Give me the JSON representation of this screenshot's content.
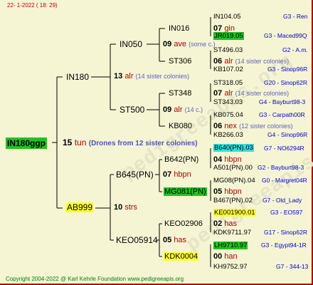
{
  "header": {
    "date": "22-  1-2022 ( 18: 29)"
  },
  "footer": {
    "copyright": "Copyright 2004-2022 @ Karl Kehrle Foundation    www.pedigreeapis.org"
  },
  "watermark": {
    "text": "pedigreeapis.org"
  },
  "root": {
    "id": "IN180ggp",
    "generation": "15",
    "queen": "tun",
    "colonies": "(Drones from 12 sister colonies)"
  },
  "sire_side": {
    "id": "IN180",
    "generation": "13",
    "queen": "alr",
    "colonies": "(14 sister colonies)",
    "a": {
      "id": "IN050",
      "generation": "09",
      "queen": "ave",
      "colonies": "(some c.)",
      "a": {
        "id": "IN016",
        "generation": "07",
        "queen": "gin",
        "a": {
          "id": "IN104.05",
          "info": "G3 - Ren"
        },
        "b": {
          "id": "JR019.05",
          "info": "G3 - Maced99Q"
        }
      },
      "b": {
        "id": "ST306",
        "generation": "06",
        "queen": "alr",
        "colonies": "(14 sister colonies)",
        "a": {
          "id": "ST496.03",
          "info": "G2 - A.m."
        },
        "b": {
          "id": "KB107.02",
          "info": "G3 - Sinop96R"
        }
      }
    },
    "b": {
      "id": "ST500",
      "generation": "09",
      "queen": "alr",
      "colonies": "(14 c.)",
      "a": {
        "id": "ST348",
        "generation": "07",
        "queen": "alr",
        "colonies": "(14 sister colonies)",
        "a": {
          "id": "ST318.05",
          "info": "G20 - Sinop62R"
        },
        "b": {
          "id": "ST343.03",
          "info": "G4 - Bayburt98-3"
        }
      },
      "b": {
        "id": "KB080",
        "generation": "06",
        "queen": "nex",
        "colonies": "(12 sister colonies)",
        "a": {
          "id": "KB075.04",
          "info": "G3 - Carpath00R"
        },
        "b": {
          "id": "KB266.03",
          "info": "G4 - Sinop96R"
        }
      }
    }
  },
  "dam_side": {
    "id": "AB999",
    "generation": "10",
    "queen": "strs",
    "a": {
      "id": "B645(PN)",
      "generation": "07",
      "queen": "hbpn",
      "a": {
        "id": "B642(PN)",
        "generation": "04",
        "queen": "hbpn",
        "a": {
          "id": "B640(PN).03",
          "info": "G7 - NO6294R"
        },
        "b": {
          "id": "A501(PN).00",
          "info": "G2 - Bayburt98-3"
        }
      },
      "b": {
        "id": "MG081(PN)",
        "generation": "05",
        "queen": "hbpn",
        "a": {
          "id": "MG08(PN).04",
          "info": "G0 - Margret04R"
        },
        "b": {
          "id": "B467(PN).02",
          "info": "G7 - Old_Lady"
        }
      }
    },
    "b": {
      "id": "KEO05914",
      "generation": "05",
      "queen": "has",
      "a": {
        "id": "KEO02906",
        "generation": "02",
        "queen": "has",
        "a": {
          "id": "KE001900.01",
          "info": "G3 - EO597"
        },
        "b": {
          "id": "KDK9711.97",
          "info": "G17 - Sinop62R"
        }
      },
      "b": {
        "id": "KDK0004",
        "generation": "00",
        "queen": "han",
        "a": {
          "id": "LH9710.97",
          "info": "G3 - Egypt94-1R"
        },
        "b": {
          "id": "KH9752.97",
          "info": "G7 - 344-13"
        }
      }
    }
  }
}
